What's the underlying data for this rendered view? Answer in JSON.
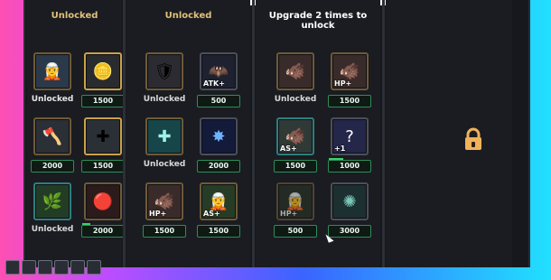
{
  "columns": [
    {
      "header": "Unlocked",
      "header_color": "#e0c27a"
    },
    {
      "header": "Unlocked",
      "header_color": "#e0c27a"
    },
    {
      "header": "Upgrade 2 times to unlock",
      "header_color": "#ffffff"
    },
    {
      "header": "",
      "header_color": "#ffffff"
    }
  ],
  "col1": {
    "items": [
      {
        "name": "unit-elf-icon",
        "label": "Unlocked",
        "tag": "",
        "progress": 0
      },
      {
        "name": "gold-coin-icon",
        "label": "",
        "price": "1500",
        "tag": "",
        "progress": 0
      },
      {
        "name": "viking-icon",
        "label": "",
        "price": "2000",
        "tag": "",
        "progress": 0
      },
      {
        "name": "healer-icon",
        "label": "",
        "price": "1500",
        "tag": "",
        "progress": 0
      },
      {
        "name": "leaf-icon",
        "label": "Unlocked",
        "tag": "",
        "progress": 0
      },
      {
        "name": "red-orb-icon",
        "label": "",
        "price": "2000",
        "tag": "",
        "progress": 0.2
      }
    ]
  },
  "col2": {
    "items": [
      {
        "name": "armor-knight-icon",
        "label": "Unlocked",
        "tag": ""
      },
      {
        "name": "shadow-atk-icon",
        "label": "",
        "price": "500",
        "tag": "ATK+"
      },
      {
        "name": "heal-cross-icon",
        "label": "Unlocked",
        "tag": ""
      },
      {
        "name": "dark-burst-icon",
        "label": "",
        "price": "2000",
        "tag": ""
      },
      {
        "name": "pig-hp-icon",
        "label": "",
        "price": "1500",
        "tag": "HP+"
      },
      {
        "name": "elf-as-icon",
        "label": "",
        "price": "1500",
        "tag": "AS+"
      }
    ]
  },
  "col3": {
    "items": [
      {
        "name": "pig-warrior-icon",
        "label": "Unlocked",
        "tag": ""
      },
      {
        "name": "pig-hp-icon-2",
        "label": "",
        "price": "1500",
        "tag": "HP+"
      },
      {
        "name": "pig-as-icon",
        "label": "",
        "price": "1500",
        "tag": "AS+"
      },
      {
        "name": "mystery-box-icon",
        "label": "",
        "price": "1000",
        "tag": "+1",
        "progress": 0.35
      },
      {
        "name": "elf-hp-icon",
        "label": "",
        "price": "500",
        "tag": "HP+"
      },
      {
        "name": "whirl-icon",
        "label": "",
        "price": "3000",
        "tag": ""
      }
    ]
  },
  "lock": {
    "icon": "padlock-icon",
    "color": "#f0b35a"
  }
}
